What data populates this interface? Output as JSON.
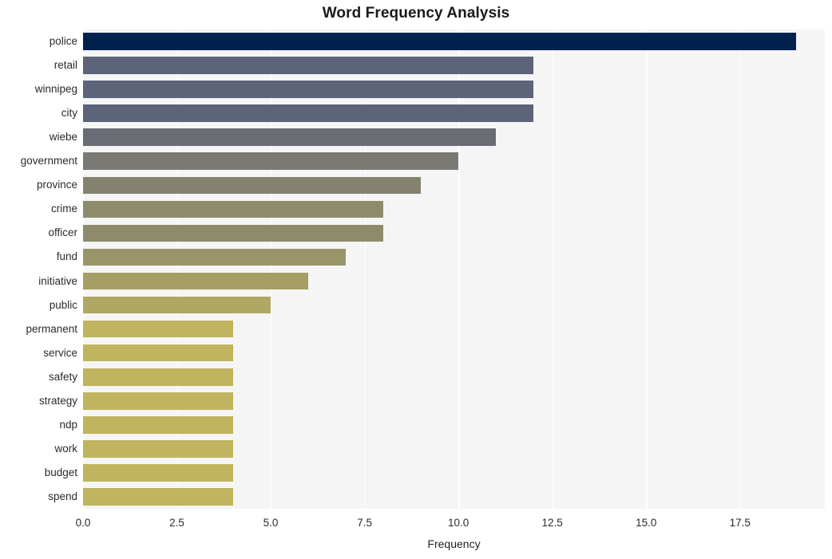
{
  "chart_data": {
    "type": "bar",
    "orientation": "horizontal",
    "title": "Word Frequency Analysis",
    "xlabel": "Frequency",
    "ylabel": "",
    "categories": [
      "police",
      "retail",
      "winnipeg",
      "city",
      "wiebe",
      "government",
      "province",
      "crime",
      "officer",
      "fund",
      "initiative",
      "public",
      "permanent",
      "service",
      "safety",
      "strategy",
      "ndp",
      "work",
      "budget",
      "spend"
    ],
    "values": [
      19,
      12,
      12,
      12,
      11,
      10,
      9,
      8,
      8,
      7,
      6,
      5,
      4,
      4,
      4,
      4,
      4,
      4,
      4,
      4
    ],
    "bar_colors": [
      "#00224e",
      "#5d6378",
      "#5d6378",
      "#5d6378",
      "#6a6c74",
      "#7a7973",
      "#84826f",
      "#8e8b6c",
      "#8e8b6c",
      "#9a9469",
      "#a69e65",
      "#b0a762",
      "#c0b45f",
      "#c0b45f",
      "#c0b45f",
      "#c0b45f",
      "#c0b45f",
      "#c0b45f",
      "#c0b45f",
      "#c0b45f"
    ],
    "xlim": [
      0,
      19.76
    ],
    "xticks": [
      0.0,
      2.5,
      5.0,
      7.5,
      10.0,
      12.5,
      15.0,
      17.5
    ],
    "xtick_labels": [
      "0.0",
      "2.5",
      "5.0",
      "7.5",
      "10.0",
      "12.5",
      "15.0",
      "17.5"
    ],
    "grid": true,
    "grid_axis": "x",
    "grid_color": "#ffffff",
    "plot_background": "#f5f5f6",
    "figure_background": "#ffffff",
    "legend": null,
    "colormap": "cividis"
  },
  "figure": {
    "title": "Word Frequency Analysis",
    "axis_label_x": "Frequency"
  }
}
